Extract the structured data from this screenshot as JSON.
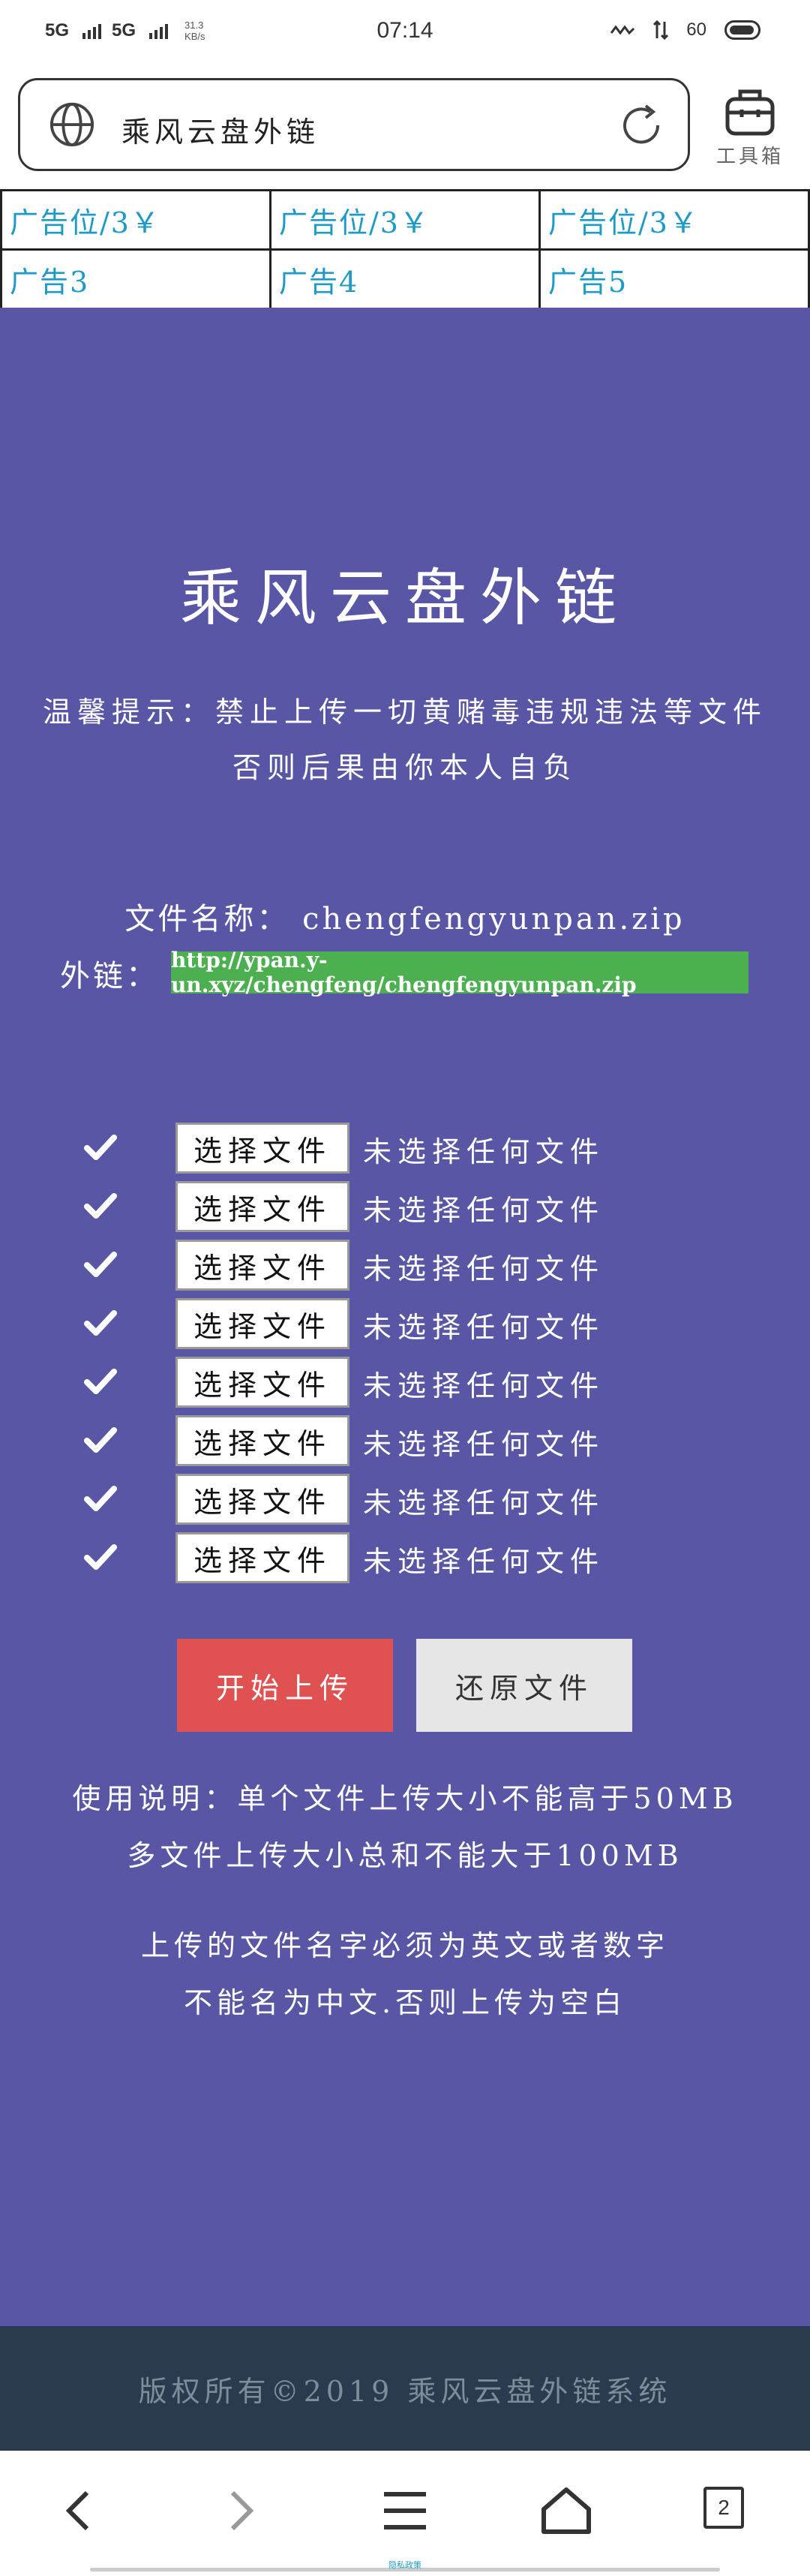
{
  "status_bar": {
    "net1": "5G",
    "net2": "5G",
    "speed_value": "31.3",
    "speed_unit": "KB/s",
    "time": "07:14",
    "wifi_icon": "wifi-icon",
    "battery_level": "60"
  },
  "address_bar": {
    "title": "乘风云盘外链",
    "globe_icon": "globe-icon",
    "refresh_icon": "refresh-icon"
  },
  "toolbox": {
    "label": "工具箱",
    "icon": "toolbox-icon"
  },
  "ads": {
    "row1": [
      "广告位/3￥",
      "广告位/3￥",
      "广告位/3￥"
    ],
    "row2": [
      "广告3",
      "广告4",
      "广告5"
    ]
  },
  "main": {
    "title": "乘风云盘外链",
    "tip_line1": "温馨提示：禁止上传一切黄赌毒违规违法等文件",
    "tip_line2": "否则后果由你本人自负",
    "file_name_label": "文件名称：",
    "file_name_value": "chengfengyunpan.zip",
    "link_label": "外链：",
    "link_value": "http://ypan.y-un.xyz/chengfeng/chengfengyunpan.zip",
    "choose_label": "选择文件",
    "no_file_label": "未选择任何文件",
    "upload_button": "开始上传",
    "reset_button": "还原文件",
    "note1": "使用说明：单个文件上传大小不能高于50MB",
    "note2": "多文件上传大小总和不能大于100MB",
    "note3": "上传的文件名字必须为英文或者数字",
    "note4": "不能名为中文.否则上传为空白"
  },
  "footer": {
    "text": "版权所有©2019 乘风云盘外链系统"
  },
  "bottom_nav": {
    "tab_count": "2",
    "indicator_label": "隐私政策"
  },
  "colors": {
    "main_bg": "#5956a6",
    "link_bg": "#4caf50",
    "upload_bg": "#e05252",
    "reset_bg": "#e6e6e6",
    "footer_bg": "#2b3b4f",
    "ad_text": "#1e9ac6"
  }
}
